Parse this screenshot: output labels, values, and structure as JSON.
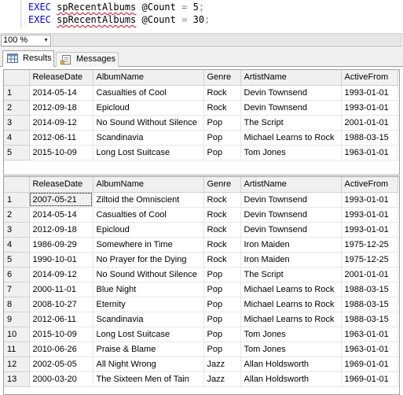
{
  "editor": {
    "lines": [
      {
        "keyword": "EXEC",
        "proc": "spRecentAlbums",
        "param": "@Count",
        "eq": "=",
        "value": "5",
        "end": ";"
      },
      {
        "keyword": "EXEC",
        "proc": "spRecentAlbums",
        "param": "@Count",
        "eq": "=",
        "value": "30",
        "end": ";"
      }
    ]
  },
  "zoom": {
    "value": "100 %"
  },
  "tabs": {
    "results": "Results",
    "messages": "Messages"
  },
  "columns": [
    "ReleaseDate",
    "AlbumName",
    "Genre",
    "ArtistName",
    "ActiveFrom"
  ],
  "grid1": {
    "rows": [
      {
        "n": "1",
        "cells": [
          "2014-05-14",
          "Casualties of Cool",
          "Rock",
          "Devin Townsend",
          "1993-01-01"
        ]
      },
      {
        "n": "2",
        "cells": [
          "2012-09-18",
          "Epicloud",
          "Rock",
          "Devin Townsend",
          "1993-01-01"
        ]
      },
      {
        "n": "3",
        "cells": [
          "2014-09-12",
          "No Sound Without Silence",
          "Pop",
          "The Script",
          "2001-01-01"
        ]
      },
      {
        "n": "4",
        "cells": [
          "2012-06-11",
          "Scandinavia",
          "Pop",
          "Michael Learns to Rock",
          "1988-03-15"
        ]
      },
      {
        "n": "5",
        "cells": [
          "2015-10-09",
          "Long Lost Suitcase",
          "Pop",
          "Tom Jones",
          "1963-01-01"
        ]
      }
    ]
  },
  "grid2": {
    "rows": [
      {
        "n": "1",
        "cells": [
          "2007-05-21",
          "Ziltoid the Omniscient",
          "Rock",
          "Devin Townsend",
          "1993-01-01"
        ]
      },
      {
        "n": "2",
        "cells": [
          "2014-05-14",
          "Casualties of Cool",
          "Rock",
          "Devin Townsend",
          "1993-01-01"
        ]
      },
      {
        "n": "3",
        "cells": [
          "2012-09-18",
          "Epicloud",
          "Rock",
          "Devin Townsend",
          "1993-01-01"
        ]
      },
      {
        "n": "4",
        "cells": [
          "1986-09-29",
          "Somewhere in Time",
          "Rock",
          "Iron Maiden",
          "1975-12-25"
        ]
      },
      {
        "n": "5",
        "cells": [
          "1990-10-01",
          "No Prayer for the Dying",
          "Rock",
          "Iron Maiden",
          "1975-12-25"
        ]
      },
      {
        "n": "6",
        "cells": [
          "2014-09-12",
          "No Sound Without Silence",
          "Pop",
          "The Script",
          "2001-01-01"
        ]
      },
      {
        "n": "7",
        "cells": [
          "2000-11-01",
          "Blue Night",
          "Pop",
          "Michael Learns to Rock",
          "1988-03-15"
        ]
      },
      {
        "n": "8",
        "cells": [
          "2008-10-27",
          "Eternity",
          "Pop",
          "Michael Learns to Rock",
          "1988-03-15"
        ]
      },
      {
        "n": "9",
        "cells": [
          "2012-06-11",
          "Scandinavia",
          "Pop",
          "Michael Learns to Rock",
          "1988-03-15"
        ]
      },
      {
        "n": "10",
        "cells": [
          "2015-10-09",
          "Long Lost Suitcase",
          "Pop",
          "Tom Jones",
          "1963-01-01"
        ]
      },
      {
        "n": "11",
        "cells": [
          "2010-06-26",
          "Praise & Blame",
          "Pop",
          "Tom Jones",
          "1963-01-01"
        ]
      },
      {
        "n": "12",
        "cells": [
          "2002-05-05",
          "All Night Wrong",
          "Jazz",
          "Allan Holdsworth",
          "1969-01-01"
        ]
      },
      {
        "n": "13",
        "cells": [
          "2000-03-20",
          "The Sixteen Men of Tain",
          "Jazz",
          "Allan Holdsworth",
          "1969-01-01"
        ]
      }
    ]
  }
}
